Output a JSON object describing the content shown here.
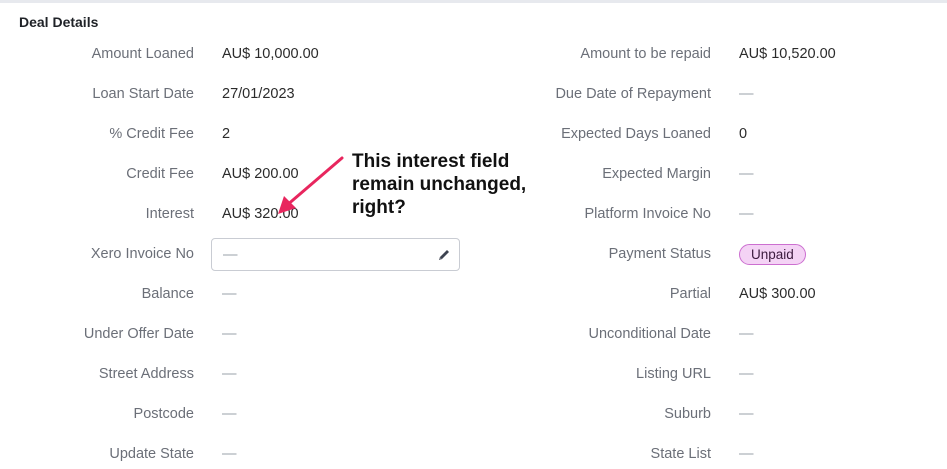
{
  "section_title": "Deal Details",
  "fields": {
    "amount_loaned": {
      "label": "Amount Loaned",
      "value": "AU$ 10,000.00"
    },
    "loan_start_date": {
      "label": "Loan Start Date",
      "value": "27/01/2023"
    },
    "credit_fee_pct": {
      "label": "% Credit Fee",
      "value": "2"
    },
    "credit_fee": {
      "label": "Credit Fee",
      "value": "AU$ 200.00"
    },
    "interest": {
      "label": "Interest",
      "value": "AU$ 320.00"
    },
    "xero_invoice_no": {
      "label": "Xero Invoice No",
      "value": "—"
    },
    "balance": {
      "label": "Balance",
      "value": "—"
    },
    "under_offer_date": {
      "label": "Under Offer Date",
      "value": "—"
    },
    "street_address": {
      "label": "Street Address",
      "value": "—"
    },
    "postcode": {
      "label": "Postcode",
      "value": "—"
    },
    "update_state": {
      "label": "Update State",
      "value": "—"
    },
    "amount_to_be_repaid": {
      "label": "Amount to be repaid",
      "value": "AU$ 10,520.00"
    },
    "due_date_of_repayment": {
      "label": "Due Date of Repayment",
      "value": "—"
    },
    "expected_days_loaned": {
      "label": "Expected Days Loaned",
      "value": "0"
    },
    "expected_margin": {
      "label": "Expected Margin",
      "value": "—"
    },
    "platform_invoice_no": {
      "label": "Platform Invoice No",
      "value": "—"
    },
    "payment_status": {
      "label": "Payment Status",
      "value": "Unpaid"
    },
    "partial": {
      "label": "Partial",
      "value": "AU$ 300.00"
    },
    "unconditional_date": {
      "label": "Unconditional Date",
      "value": "—"
    },
    "listing_url": {
      "label": "Listing URL",
      "value": "—"
    },
    "suburb": {
      "label": "Suburb",
      "value": "—"
    },
    "state_list": {
      "label": "State List",
      "value": "—"
    }
  },
  "annotation": {
    "text": "This interest field\nremain unchanged,\nright?"
  },
  "icons": {
    "edit": "pencil-icon",
    "annotation_arrow": "arrow-icon"
  },
  "colors": {
    "badge_bg": "#f4d3f5",
    "badge_border": "#cc6fd0",
    "arrow": "#e8265e"
  }
}
